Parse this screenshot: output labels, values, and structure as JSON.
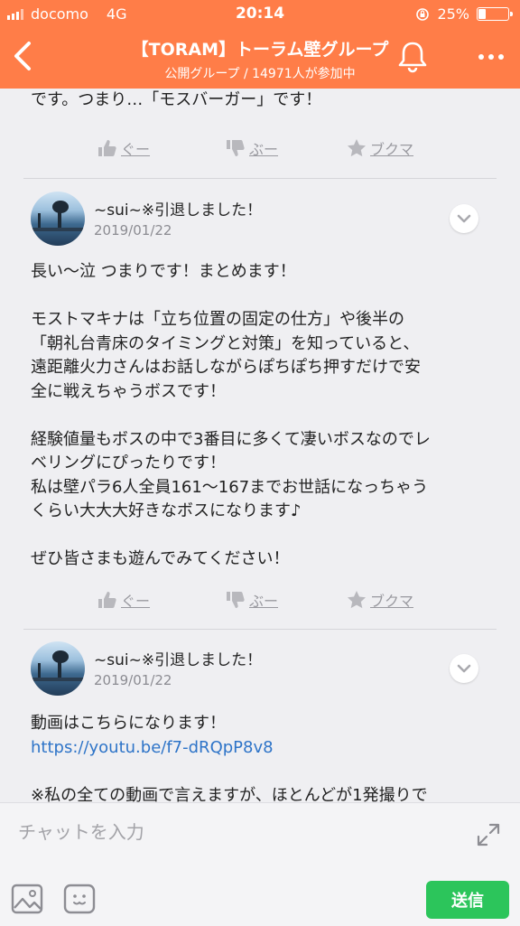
{
  "status": {
    "carrier": "docomo",
    "network": "4G",
    "time": "20:14",
    "battery": "25%"
  },
  "header": {
    "title": "【TORAM】トーラム壁グループ",
    "subtitle": "公開グループ / 14971人が参加中",
    "color": "#ff7d48"
  },
  "top_post": {
    "tail_text": "です。つまり…「モスバーガー」です！"
  },
  "actions": {
    "good": "ぐー",
    "boo": "ぶー",
    "bookmark": "ブクマ"
  },
  "posts": [
    {
      "user": "~sui~※引退しました！",
      "date": "2019/01/22",
      "lines": [
        "長い〜泣 つまりです！まとめます！",
        "",
        "モストマキナは「立ち位置の固定の仕方」や後半の",
        "「朝礼台青床のタイミングと対策」を知っていると、",
        "遠距離火力さんはお話しながらぽちぽち押すだけで安",
        "全に戦えちゃうボスです！",
        "",
        "経験値量もボスの中で3番目に多くて凄いボスなのでレ",
        "ベリングにぴったりです！",
        "私は壁パラ6人全員161〜167までお世話になっちゃう",
        "くらい大大大好きなボスになります♪",
        "",
        "ぜひ皆さまも遊んでみてください！"
      ]
    },
    {
      "user": "~sui~※引退しました！",
      "date": "2019/01/22",
      "line1": "動画はこちらになります！",
      "link": "https://youtu.be/f7-dRQpP8v8",
      "line3": "※私の全ての動画で言えますが、ほとんどが1発撮りで"
    }
  ],
  "composer": {
    "placeholder": "チャットを入力",
    "send_label": "送信",
    "send_color": "#2cc55b"
  }
}
